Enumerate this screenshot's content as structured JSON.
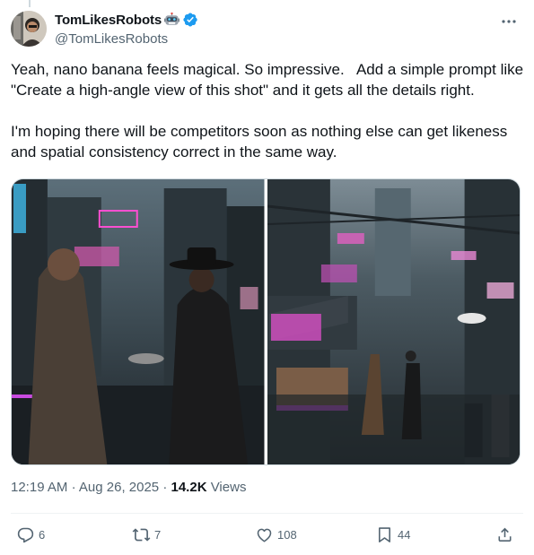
{
  "author": {
    "display_name": "TomLikesRobots",
    "handle": "@TomLikesRobots"
  },
  "tweet": {
    "text": "Yeah, nano banana feels magical. So impressive.   Add a simple prompt like \"Create a high-angle view of this shot\" and it gets all the details right.\n\nI'm hoping there will be competitors soon as nothing else can get likeness and spatial consistency correct in the same way."
  },
  "meta": {
    "time": "12:19 AM",
    "date": "Aug 26, 2025",
    "sep": "·",
    "views_count": "14.2K",
    "views_label": "Views"
  },
  "actions": {
    "replies": "6",
    "reposts": "7",
    "likes": "108",
    "bookmarks": "44"
  },
  "icons": {
    "robot": "robot-emoji",
    "verified": "verified-badge",
    "more": "more-icon",
    "reply": "reply-icon",
    "repost": "repost-icon",
    "like": "heart-icon",
    "bookmark": "bookmark-icon",
    "share": "share-icon"
  },
  "colors": {
    "verified": "#1d9bf0",
    "secondary_text": "#536471",
    "primary_text": "#0f1419"
  }
}
